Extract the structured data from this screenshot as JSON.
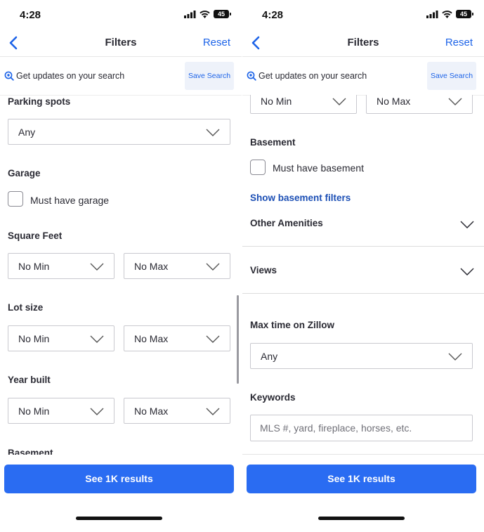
{
  "status_bar": {
    "time": "4:28",
    "battery": "45"
  },
  "nav": {
    "title": "Filters",
    "reset_label": "Reset"
  },
  "save_search": {
    "text": "Get updates on your search",
    "button_label": "Save Search"
  },
  "left_screen": {
    "parking": {
      "label": "Parking spots",
      "value": "Any"
    },
    "garage": {
      "label": "Garage",
      "checkbox_label": "Must have garage"
    },
    "square_feet": {
      "label": "Square Feet",
      "min": "No Min",
      "max": "No Max"
    },
    "lot_size": {
      "label": "Lot size",
      "min": "No Min",
      "max": "No Max"
    },
    "year_built": {
      "label": "Year built",
      "min": "No Min",
      "max": "No Max"
    },
    "basement_partial_label": "Basement"
  },
  "right_screen": {
    "range_top": {
      "min": "No Min",
      "max": "No Max"
    },
    "basement": {
      "label": "Basement",
      "checkbox_label": "Must have basement",
      "link": "Show basement filters"
    },
    "other_amenities": "Other Amenities",
    "views": "Views",
    "max_time": {
      "label": "Max time on Zillow",
      "value": "Any"
    },
    "keywords": {
      "label": "Keywords",
      "placeholder": "MLS #, yard, fireplace, horses, etc."
    }
  },
  "cta_label": "See 1K results",
  "icons": {
    "back": "chevron-left-icon",
    "save_search": "search-bell-icon",
    "dropdown": "chevron-down-icon",
    "signal": "signal-icon",
    "wifi": "wifi-icon",
    "battery": "battery-icon"
  },
  "colors": {
    "accent": "#1c63e8",
    "cta": "#2a6cf2",
    "link": "#1c4fb5",
    "text": "#2a2a33"
  }
}
